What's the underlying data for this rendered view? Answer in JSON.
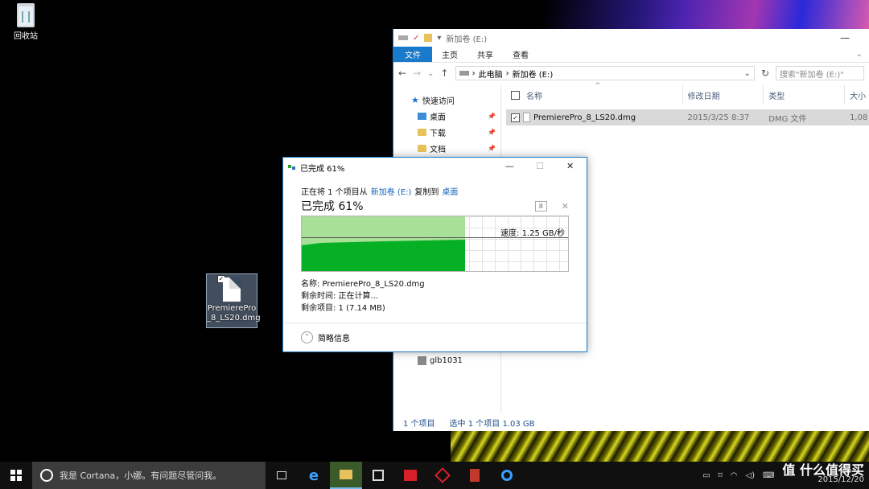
{
  "desktop": {
    "recycle_bin_label": "回收站",
    "file_label_line1": "PremierePro",
    "file_label_line2": "_8_LS20.dmg"
  },
  "explorer": {
    "title": "新加卷 (E:)",
    "ribbon_tabs": [
      "文件",
      "主页",
      "共享",
      "查看"
    ],
    "breadcrumb": [
      "此电脑",
      "新加卷 (E:)"
    ],
    "search_placeholder": "搜索\"新加卷 (E:)\"",
    "nav_items": [
      {
        "label": "快速访问",
        "icon": "star-icon"
      },
      {
        "label": "桌面",
        "icon": "desktop-folder-icon"
      },
      {
        "label": "下载",
        "icon": "download-folder-icon"
      },
      {
        "label": "文档",
        "icon": "documents-folder-icon"
      },
      {
        "label": "glb1031",
        "icon": "user-folder-icon"
      }
    ],
    "columns": [
      "名称",
      "修改日期",
      "类型",
      "大小"
    ],
    "files": [
      {
        "name": "PremierePro_8_LS20.dmg",
        "modified": "2015/3/25 8:37",
        "type": "DMG 文件",
        "size": "1,08"
      }
    ],
    "status_count": "1 个项目",
    "status_selected": "选中 1 个项目  1.03 GB"
  },
  "copy_dialog": {
    "title": "已完成 61%",
    "copy_prefix": "正在将 1 个项目从",
    "source": "新加卷 (E:)",
    "copy_mid": "复制到",
    "dest": "桌面",
    "percent_text": "已完成 61%",
    "progress": 0.61,
    "speed_text": "速度: 1.25 GB/秒",
    "name_line": "名称: PremierePro_8_LS20.dmg",
    "time_line": "剩余时间: 正在计算...",
    "items_line": "剩余项目: 1 (7.14 MB)",
    "details_label": "简略信息",
    "pause_icon": "pause-icon",
    "colors": {
      "fill": "#06b025",
      "light": "#a8e098",
      "accent": "#1979ca"
    }
  },
  "taskbar": {
    "cortana_text": "我是 Cortana，小娜。有问题尽管问我。",
    "clock_date": "2015/12/20",
    "brand_text": "值 什么值得买"
  }
}
